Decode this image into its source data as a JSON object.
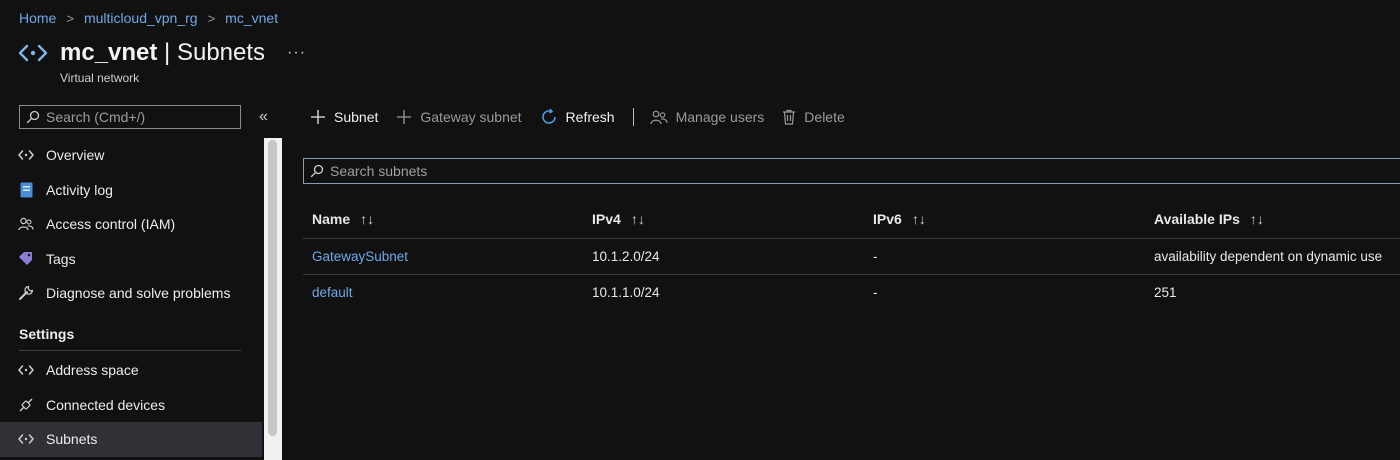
{
  "breadcrumb": [
    {
      "label": "Home"
    },
    {
      "label": "multicloud_vpn_rg"
    },
    {
      "label": "mc_vnet"
    }
  ],
  "header": {
    "resource_name": "mc_vnet",
    "separator": " | ",
    "page": "Subnets",
    "more": "···",
    "subtitle": "Virtual network",
    "icon": "vnet-icon"
  },
  "sidebar": {
    "search_placeholder": "Search (Cmd+/)",
    "collapse": "«",
    "items": [
      {
        "label": "Overview",
        "icon": "vnet-icon"
      },
      {
        "label": "Activity log",
        "icon": "activity-log-icon"
      },
      {
        "label": "Access control (IAM)",
        "icon": "people-icon"
      },
      {
        "label": "Tags",
        "icon": "tag-icon"
      },
      {
        "label": "Diagnose and solve problems",
        "icon": "wrench-icon"
      }
    ],
    "section_label": "Settings",
    "settings_items": [
      {
        "label": "Address space",
        "icon": "vnet-icon"
      },
      {
        "label": "Connected devices",
        "icon": "plug-icon"
      },
      {
        "label": "Subnets",
        "icon": "vnet-icon",
        "active": true
      }
    ]
  },
  "toolbar": {
    "subnet": "Subnet",
    "gateway_subnet": "Gateway subnet",
    "refresh": "Refresh",
    "manage_users": "Manage users",
    "delete": "Delete"
  },
  "table": {
    "search_placeholder": "Search subnets",
    "columns": [
      "Name",
      "IPv4",
      "IPv6",
      "Available IPs"
    ],
    "sort_glyph": "↑↓",
    "rows": [
      {
        "name": "GatewaySubnet",
        "ipv4": "10.1.2.0/24",
        "ipv6": "-",
        "available": "availability dependent on dynamic use"
      },
      {
        "name": "default",
        "ipv4": "10.1.1.0/24",
        "ipv6": "-",
        "available": "251"
      }
    ]
  },
  "colors": {
    "background": "#111112",
    "link": "#6fa8e6",
    "accent_blue": "#4aa3f0",
    "active_nav": "#2f3136"
  }
}
